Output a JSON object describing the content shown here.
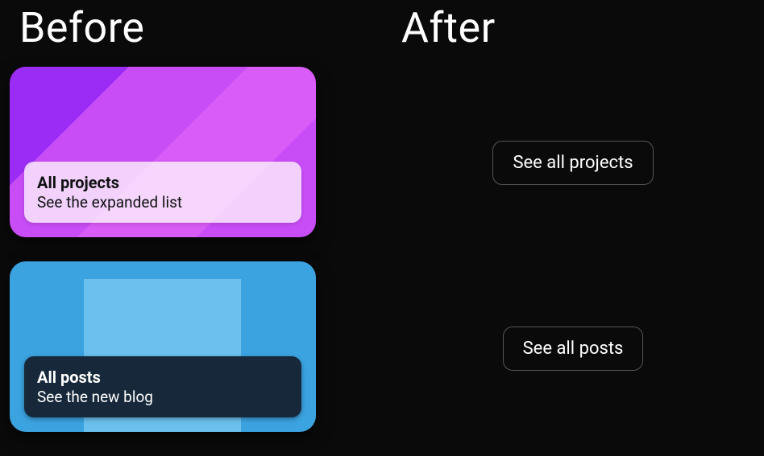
{
  "before": {
    "heading": "Before",
    "cards": {
      "projects": {
        "title": "All projects",
        "subtitle": "See the expanded list"
      },
      "posts": {
        "title": "All posts",
        "subtitle": "See the new blog"
      }
    }
  },
  "after": {
    "heading": "After",
    "buttons": {
      "projects": "See all projects",
      "posts": "See all posts"
    }
  }
}
